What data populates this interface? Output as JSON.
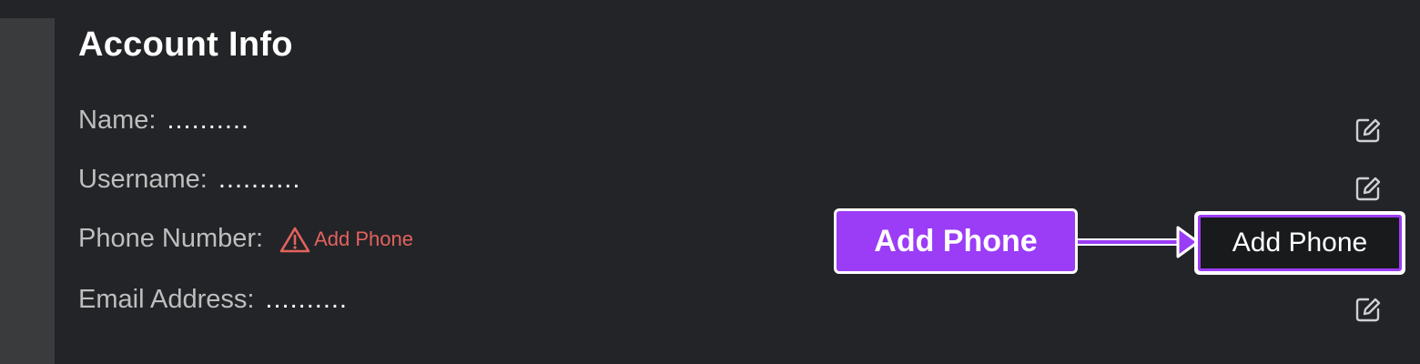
{
  "section": {
    "title": "Account Info"
  },
  "fields": {
    "name": {
      "label": "Name:",
      "value": ".........."
    },
    "username": {
      "label": "Username:",
      "value": ".........."
    },
    "phone": {
      "label": "Phone Number:",
      "link": "Add Phone"
    },
    "email": {
      "label": "Email Address:",
      "value": ".........."
    }
  },
  "callout": {
    "label": "Add Phone"
  },
  "actions": {
    "add_phone_button": "Add Phone"
  },
  "colors": {
    "background": "#232427",
    "left_rail": "#393b3d",
    "accent": "#9b3cf6",
    "warning": "#e3625e",
    "label": "#bdbebe",
    "text": "#ffffff"
  },
  "icons": {
    "edit": "edit-icon",
    "warning": "warning-icon",
    "arrow": "arrow-right-icon"
  }
}
